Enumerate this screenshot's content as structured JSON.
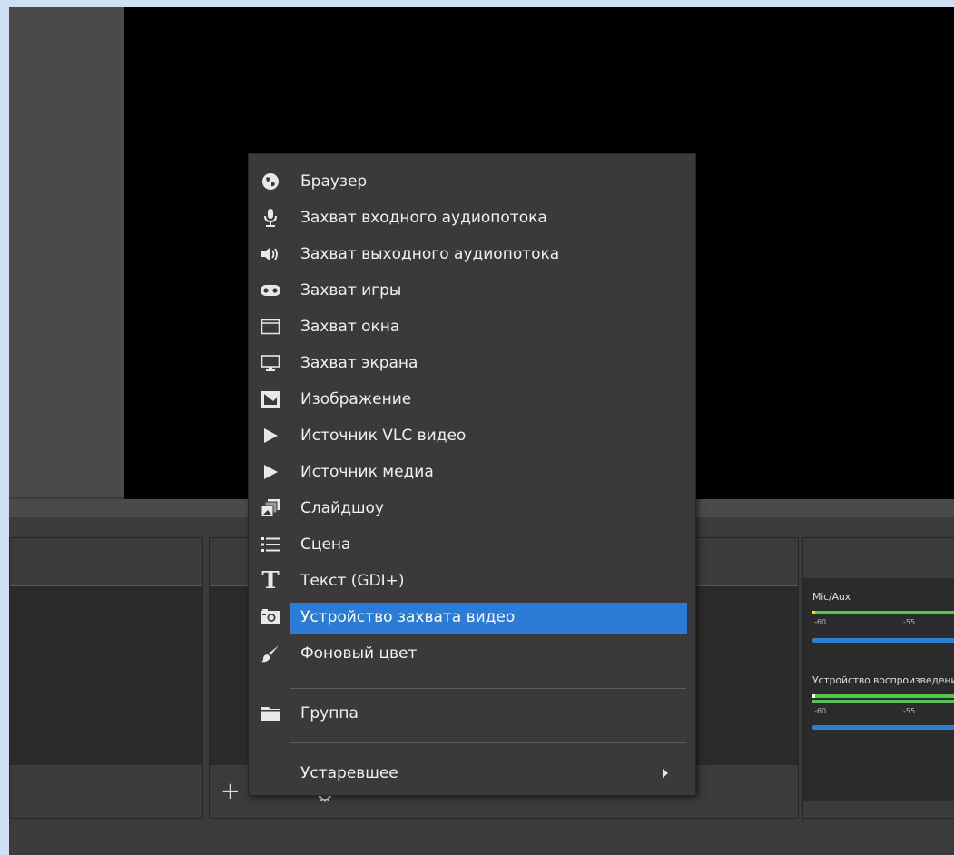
{
  "menu": {
    "items": [
      {
        "label": "Браузер",
        "icon": "globe-icon"
      },
      {
        "label": "Захват входного аудиопотока",
        "icon": "microphone-icon"
      },
      {
        "label": "Захват выходного аудиопотока",
        "icon": "speaker-icon"
      },
      {
        "label": "Захват игры",
        "icon": "gamepad-icon"
      },
      {
        "label": "Захват окна",
        "icon": "window-icon"
      },
      {
        "label": "Захват экрана",
        "icon": "monitor-icon"
      },
      {
        "label": "Изображение",
        "icon": "image-icon"
      },
      {
        "label": "Источник VLC видео",
        "icon": "play-icon"
      },
      {
        "label": "Источник медиа",
        "icon": "play-icon"
      },
      {
        "label": "Слайдшоу",
        "icon": "slideshow-icon"
      },
      {
        "label": "Сцена",
        "icon": "list-icon"
      },
      {
        "label": "Текст (GDI+)",
        "icon": "text-icon"
      },
      {
        "label": "Устройство захвата видео",
        "icon": "camera-icon",
        "selected": true
      },
      {
        "label": "Фоновый цвет",
        "icon": "brush-icon"
      }
    ],
    "group": {
      "label": "Группа",
      "icon": "folder-icon"
    },
    "deprecated": {
      "label": "Устаревшее"
    }
  },
  "mixer": {
    "tracks": [
      {
        "name": "Mic/Aux"
      },
      {
        "name": "Устройство воспроизведения"
      }
    ],
    "scale": [
      "-60",
      "-55"
    ]
  },
  "colors": {
    "selection": "#2a7cd6",
    "meter": "#56c44f",
    "slider": "#2d7fd6",
    "background": "#3b3b3b"
  }
}
